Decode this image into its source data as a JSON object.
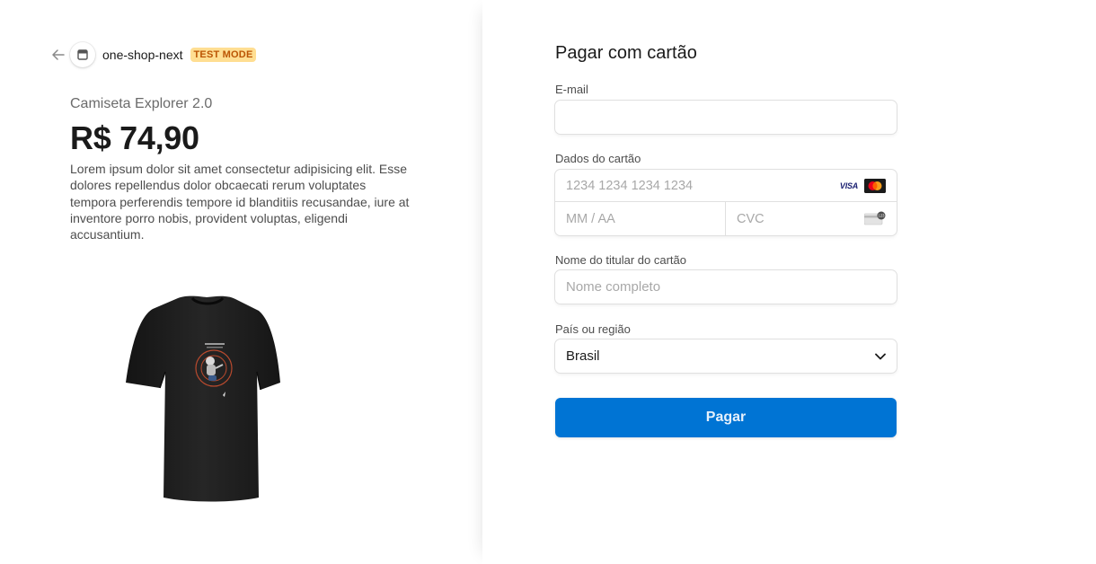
{
  "header": {
    "shop_name": "one-shop-next",
    "badge": "TEST MODE"
  },
  "product": {
    "name": "Camiseta Explorer 2.0",
    "price": "R$ 74,90",
    "description": "Lorem ipsum dolor sit amet consectetur adipisicing elit. Esse dolores repellendus dolor obcaecati rerum voluptates tempora perferendis tempore id blanditiis recusandae, iure at inventore porro nobis, provident voluptas, eligendi accusantium."
  },
  "form": {
    "title": "Pagar com cartão",
    "email": {
      "label": "E-mail",
      "value": "",
      "placeholder": ""
    },
    "card": {
      "label": "Dados do cartão",
      "number_placeholder": "1234 1234 1234 1234",
      "expiry_placeholder": "MM / AA",
      "cvc_placeholder": "CVC",
      "brands": [
        "VISA",
        "mastercard"
      ]
    },
    "name": {
      "label": "Nome do titular do cartão",
      "placeholder": "Nome completo"
    },
    "country": {
      "label": "País ou região",
      "value": "Brasil"
    },
    "submit_label": "Pagar"
  },
  "icons": {
    "back": "arrow-left-icon",
    "store": "store-icon",
    "dropdown": "chevron-down-icon",
    "cvc": "card-cvc-icon"
  },
  "colors": {
    "accent": "#0074d4",
    "badge_bg": "#ffde92",
    "badge_text": "#bb5504"
  }
}
